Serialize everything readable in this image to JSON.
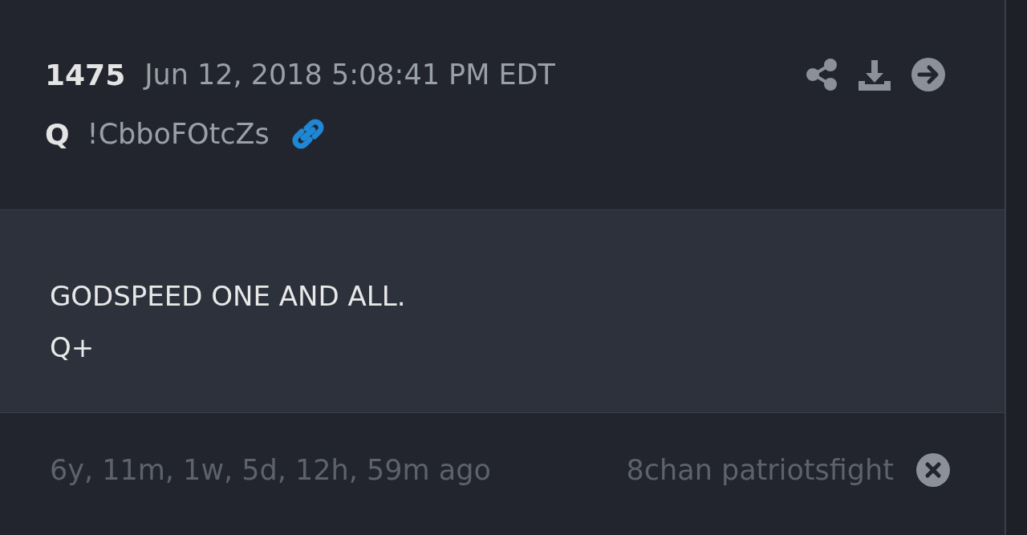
{
  "post": {
    "number": "1475",
    "timestamp": "Jun 12, 2018 5:08:41 PM EDT",
    "author": "Q",
    "tripcode": "!CbboFOtcZs"
  },
  "body": {
    "lines": [
      "GODSPEED ONE AND ALL.",
      "Q+"
    ]
  },
  "footer": {
    "age": "6y, 11m, 1w, 5d, 12h, 59m ago",
    "source": "8chan patriotsfight"
  }
}
